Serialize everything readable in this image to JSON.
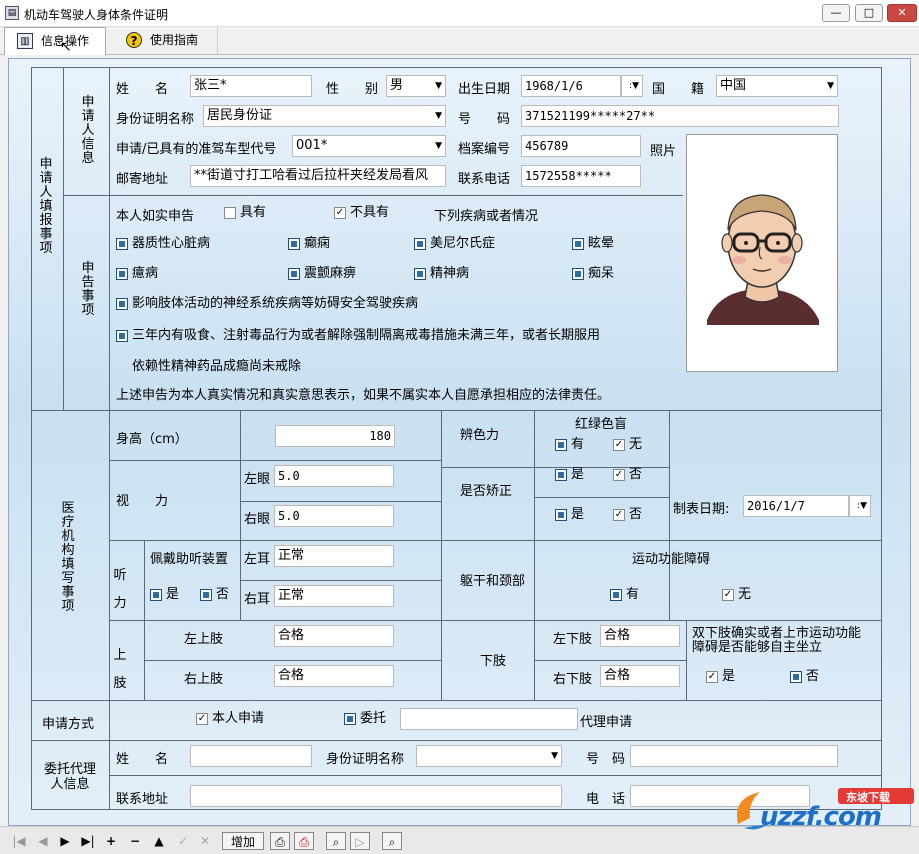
{
  "window": {
    "title": "机动车驾驶人身体条件证明"
  },
  "menu": {
    "tabs": [
      {
        "label": "信息操作"
      },
      {
        "label": "使用指南"
      }
    ]
  },
  "sections": {
    "applicant_fill": "申请人填报事项",
    "applicant_info": "申请人信息",
    "declaration": "申告事项",
    "medical": "医疗机构填写事项",
    "agent_info": "委托代理人信息"
  },
  "applicant": {
    "name_label": "姓　　名",
    "name": "张三*",
    "gender_label": "性　　别",
    "gender": "男",
    "birth_label": "出生日期",
    "birth": "1968/1/6",
    "nationality_label": "国　　籍",
    "nationality": "中国",
    "id_type_label": "身份证明名称",
    "id_type": "居民身份证",
    "id_no_label": "号　　码",
    "id_no": "371521199*****27**",
    "vehicle_label": "申请/已具有的准驾车型代号",
    "vehicle": "001*",
    "file_no_label": "档案编号",
    "file_no": "456789",
    "photo_label": "照片",
    "address_label": "邮寄地址",
    "address": "**街道寸打工哈看过后拉杆夹经发局看风",
    "phone_label": "联系电话",
    "phone": "1572558*****"
  },
  "declaration": {
    "intro": "本人如实申告",
    "has": "具有",
    "has_not": "不具有",
    "following": "下列疾病或者情况",
    "diseases": [
      "器质性心脏病",
      "癫痫",
      "美尼尔氏症",
      "眩晕",
      "癔病",
      "震颤麻痹",
      "精神病",
      "痴呆"
    ],
    "nerve": "影响肢体活动的神经系统疾病等妨碍安全驾驶疾病",
    "drug_line1": "三年内有吸食、注射毒品行为或者解除强制隔离戒毒措施未满三年，或者长期服用",
    "drug_line2": "依赖性精神药品成瘾尚未戒除",
    "statement": "上述申告为本人真实情况和真实意思表示，如果不属实本人自愿承担相应的法律责任。"
  },
  "medical": {
    "height_label": "身高（cm）",
    "height": "180",
    "color_label": "辨色力",
    "color_blind_label": "红绿色盲",
    "yes": "有",
    "no": "无",
    "shi": "是",
    "fou": "否",
    "vision_label": "视　　力",
    "left_eye": "左眼",
    "left_eye_val": "5.0",
    "right_eye": "右眼",
    "right_eye_val": "5.0",
    "corrected_label": "是否矫正",
    "date_label": "制表日期:",
    "date": "2016/1/7",
    "hearing_label": "听力",
    "hearing_aid_label": "佩戴助听装置",
    "left_ear": "左耳",
    "left_ear_val": "正常",
    "right_ear": "右耳",
    "right_ear_val": "正常",
    "trunk_label": "躯干和颈部",
    "motor_label": "运动功能障碍",
    "upper_label": "上肢",
    "upper_left": "左上肢",
    "upper_left_val": "合格",
    "upper_right": "右上肢",
    "upper_right_val": "合格",
    "lower_label": "下肢",
    "lower_left": "左下肢",
    "lower_left_val": "合格",
    "lower_right": "右下肢",
    "lower_right_val": "合格",
    "lower_missing": "双下肢确实或者上市运动功能障碍是否能够自主坐立"
  },
  "application": {
    "method_label": "申请方式",
    "self": "本人申请",
    "entrust": "委托",
    "agent_apply": "代理申请"
  },
  "agent": {
    "name_label": "姓　　名",
    "id_type_label": "身份证明名称",
    "id_no_label": "号　码",
    "address_label": "联系地址",
    "phone_label": "电　话"
  },
  "toolbar": {
    "add": "增加"
  },
  "watermark": {
    "text": "uzzf.com",
    "cn": "东坡下载"
  }
}
